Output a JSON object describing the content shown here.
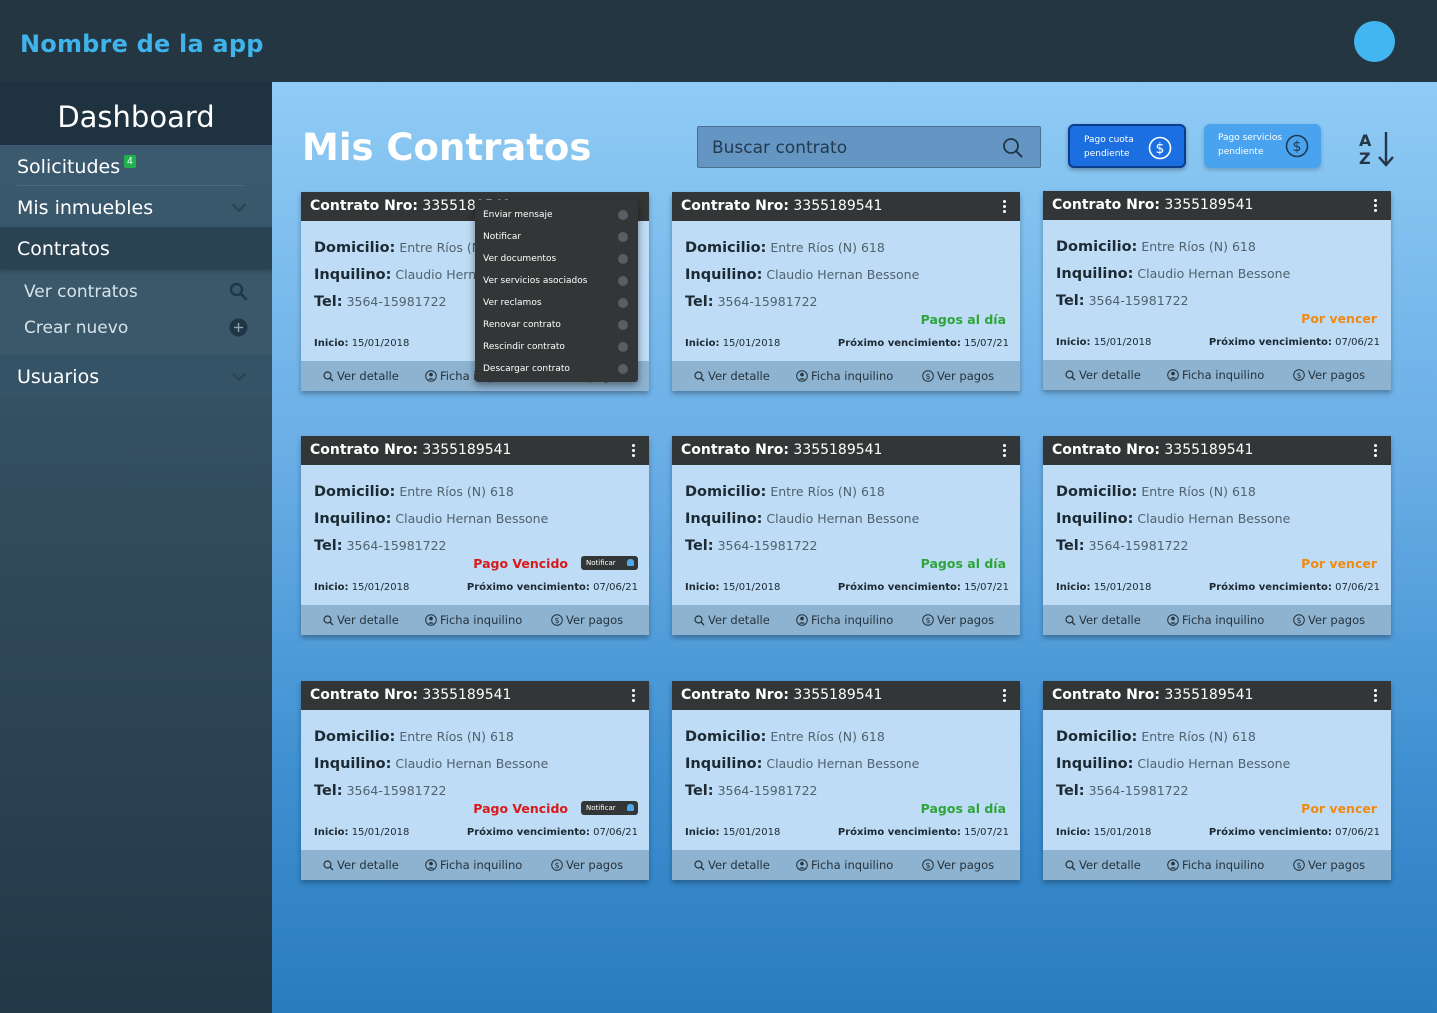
{
  "app": {
    "name": "Nombre de la app"
  },
  "sidebar": {
    "title": "Dashboard",
    "solicitudes": {
      "label": "Solicitudes",
      "badge": "4"
    },
    "inmuebles": {
      "label": "Mis inmuebles"
    },
    "contratos": {
      "label": "Contratos",
      "sub": [
        {
          "label": "Ver contratos",
          "icon": "search-icon"
        },
        {
          "label": "Crear nuevo",
          "icon": "plus-circle-icon"
        }
      ]
    },
    "usuarios": {
      "label": "Usuarios"
    }
  },
  "header": {
    "title": "Mis Contratos",
    "search_placeholder": "Buscar contrato",
    "pago_cuota": [
      "Pago cuota",
      "pendiente"
    ],
    "pago_servicios": [
      "Pago servicios",
      "pendiente"
    ]
  },
  "card_labels": {
    "contrato": "Contrato Nro:",
    "domicilio": "Domicilio:",
    "inquilino": "Inquilino:",
    "tel": "Tel:",
    "inicio": "Inicio:",
    "proximo": "Próximo vencimiento:",
    "ver_detalle": "Ver detalle",
    "ficha": "Ficha inquilino",
    "ver_pagos": "Ver pagos",
    "notificar": "Notificar"
  },
  "contracts": [
    {
      "nro": "3355189541",
      "domicilio": "Entre Ríos (N) 618",
      "inquilino": "Claudio Hernan Bessone",
      "tel": "3564-15981722",
      "inicio": "15/01/2018",
      "status": "",
      "proximo": ""
    },
    {
      "nro": "3355189541",
      "domicilio": "Entre Ríos (N) 618",
      "inquilino": "Claudio Hernan Bessone",
      "tel": "3564-15981722",
      "inicio": "15/01/2018",
      "status": "Pagos al día",
      "status_type": "ok",
      "proximo": "15/07/21"
    },
    {
      "nro": "3355189541",
      "domicilio": "Entre Ríos (N) 618",
      "inquilino": "Claudio Hernan Bessone",
      "tel": "3564-15981722",
      "inicio": "15/01/2018",
      "status": "Por vencer",
      "status_type": "warn",
      "proximo": "07/06/21"
    },
    {
      "nro": "3355189541",
      "domicilio": "Entre Ríos (N) 618",
      "inquilino": "Claudio Hernan Bessone",
      "tel": "3564-15981722",
      "inicio": "15/01/2018",
      "status": "Pago Vencido",
      "status_type": "bad",
      "proximo": "07/06/21"
    },
    {
      "nro": "3355189541",
      "domicilio": "Entre Ríos (N) 618",
      "inquilino": "Claudio Hernan Bessone",
      "tel": "3564-15981722",
      "inicio": "15/01/2018",
      "status": "Pagos al día",
      "status_type": "ok",
      "proximo": "15/07/21"
    },
    {
      "nro": "3355189541",
      "domicilio": "Entre Ríos (N) 618",
      "inquilino": "Claudio Hernan Bessone",
      "tel": "3564-15981722",
      "inicio": "15/01/2018",
      "status": "Por vencer",
      "status_type": "warn",
      "proximo": "07/06/21"
    },
    {
      "nro": "3355189541",
      "domicilio": "Entre Ríos (N) 618",
      "inquilino": "Claudio Hernan Bessone",
      "tel": "3564-15981722",
      "inicio": "15/01/2018",
      "status": "Pago Vencido",
      "status_type": "bad",
      "proximo": "07/06/21"
    },
    {
      "nro": "3355189541",
      "domicilio": "Entre Ríos (N) 618",
      "inquilino": "Claudio Hernan Bessone",
      "tel": "3564-15981722",
      "inicio": "15/01/2018",
      "status": "Pagos al día",
      "status_type": "ok",
      "proximo": "15/07/21"
    },
    {
      "nro": "3355189541",
      "domicilio": "Entre Ríos (N) 618",
      "inquilino": "Claudio Hernan Bessone",
      "tel": "3564-15981722",
      "inicio": "15/01/2018",
      "status": "Por vencer",
      "status_type": "warn",
      "proximo": "07/06/21"
    }
  ],
  "context_menu": [
    {
      "label": "Enviar mensaje",
      "icon": "message-icon"
    },
    {
      "label": "Notificar",
      "icon": "bell-icon"
    },
    {
      "label": "Ver documentos",
      "icon": "document-icon"
    },
    {
      "label": "Ver servicios asociados",
      "icon": "settings-icon"
    },
    {
      "label": "Ver reclamos",
      "icon": "alert-icon"
    },
    {
      "label": "Renovar contrato",
      "icon": "renew-icon"
    },
    {
      "label": "Rescindir contrato",
      "icon": "cancel-icon"
    },
    {
      "label": "Descargar contrato",
      "icon": "download-icon"
    }
  ],
  "colors": {
    "accent": "#3fb3ea",
    "ok": "#2ea43b",
    "warn": "#f08a12",
    "bad": "#d81a1a"
  }
}
